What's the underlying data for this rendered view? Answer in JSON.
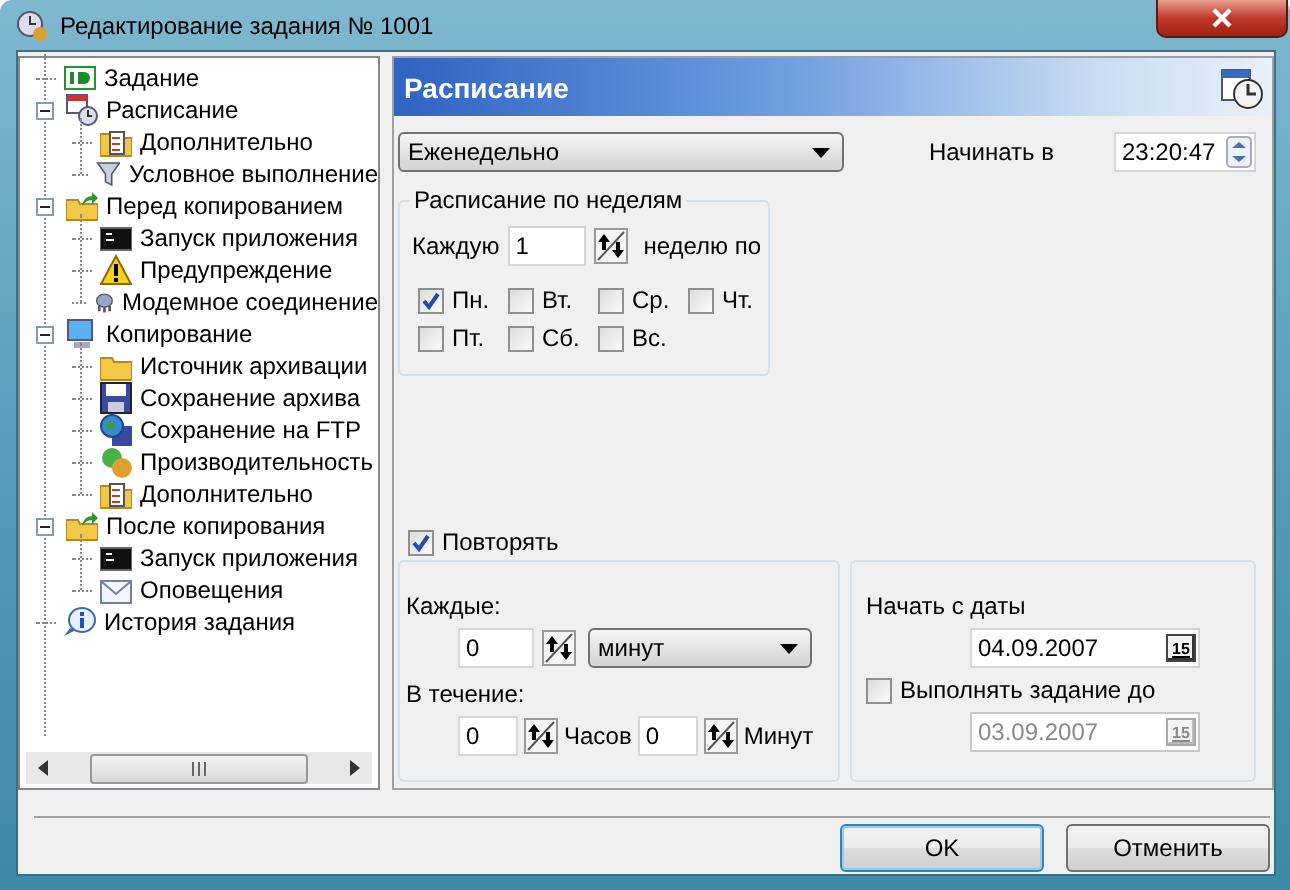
{
  "window": {
    "title": "Редактирование задания № 1001"
  },
  "tree": [
    {
      "label": "Задание",
      "kind": "id"
    },
    {
      "label": "Расписание",
      "kind": "calendar",
      "expanded": true,
      "children": [
        {
          "label": "Дополнительно",
          "kind": "tasks"
        },
        {
          "label": "Условное выполнение",
          "kind": "filter"
        }
      ]
    },
    {
      "label": "Перед копированием",
      "kind": "folderarrow",
      "expanded": true,
      "children": [
        {
          "label": "Запуск приложения",
          "kind": "console"
        },
        {
          "label": "Предупреждение",
          "kind": "warning"
        },
        {
          "label": "Модемное соединение",
          "kind": "plug"
        }
      ]
    },
    {
      "label": "Копирование",
      "kind": "computer",
      "expanded": true,
      "children": [
        {
          "label": "Источник архивации",
          "kind": "folder"
        },
        {
          "label": "Сохранение архива",
          "kind": "floppy"
        },
        {
          "label": "Сохранение на FTP",
          "kind": "globe"
        },
        {
          "label": "Производительность",
          "kind": "gears"
        },
        {
          "label": "Дополнительно",
          "kind": "tasks"
        }
      ]
    },
    {
      "label": "После копирования",
      "kind": "folderarrow",
      "expanded": true,
      "children": [
        {
          "label": "Запуск приложения",
          "kind": "console"
        },
        {
          "label": "Оповещения",
          "kind": "envelope"
        }
      ]
    },
    {
      "label": "История задания",
      "kind": "info"
    }
  ],
  "panel": {
    "title": "Расписание"
  },
  "schedule": {
    "frequency": "Еженедельно",
    "start_label": "Начинать в",
    "start_time": "23:20:47"
  },
  "weekly": {
    "legend": "Расписание по неделям",
    "every_label": "Каждую",
    "every_value": "1",
    "unit_label": "неделю по",
    "days": [
      {
        "label": "Пн.",
        "checked": true
      },
      {
        "label": "Вт.",
        "checked": false
      },
      {
        "label": "Ср.",
        "checked": false
      },
      {
        "label": "Чт.",
        "checked": false
      },
      {
        "label": "Пт.",
        "checked": false
      },
      {
        "label": "Сб.",
        "checked": false
      },
      {
        "label": "Вс.",
        "checked": false
      }
    ]
  },
  "repeat": {
    "label": "Повторять",
    "checked": true,
    "every_label": "Каждые:",
    "every_value": "0",
    "every_unit": "минут",
    "during_label": "В течение:",
    "hours_value": "0",
    "hours_label": "Часов",
    "minutes_value": "0",
    "minutes_label": "Минут"
  },
  "dates": {
    "start_label": "Начать с даты",
    "start_date": "04.09.2007",
    "start_calendar": "15",
    "end_label": "Выполнять задание до",
    "end_checked": false,
    "end_date": "03.09.2007",
    "end_calendar": "15"
  },
  "buttons": [
    {
      "label": "OK",
      "default": true
    },
    {
      "label": "Отменить",
      "default": false
    }
  ]
}
